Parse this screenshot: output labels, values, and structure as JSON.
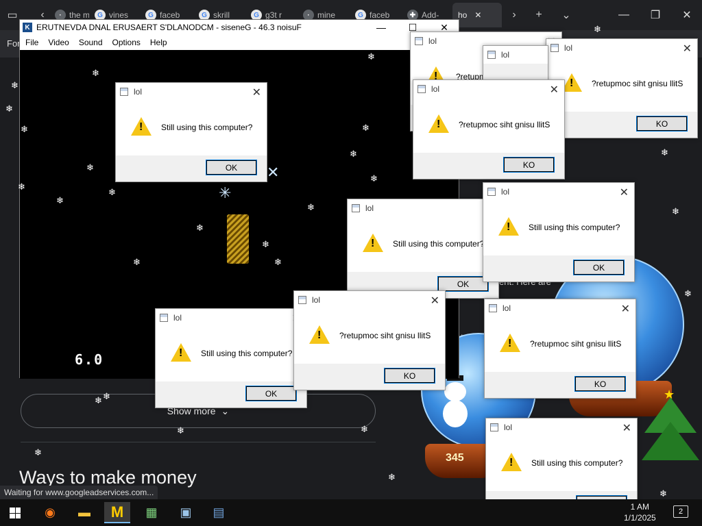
{
  "browser": {
    "tabs": [
      {
        "label": "the m",
        "icon": "page-icon"
      },
      {
        "label": "vines",
        "icon": "google-icon"
      },
      {
        "label": "faceb",
        "icon": "google-icon"
      },
      {
        "label": "skrill",
        "icon": "google-icon"
      },
      {
        "label": "g3t r",
        "icon": "google-icon"
      },
      {
        "label": "mine",
        "icon": "page-icon"
      },
      {
        "label": "faceb",
        "icon": "google-icon"
      },
      {
        "label": "Add-",
        "icon": "puzzle-icon"
      },
      {
        "label": "ho",
        "icon": "page-icon",
        "active": true
      }
    ],
    "page": {
      "nav_text": "For",
      "behind_text_1": "ent. Here are",
      "behind_text_2": "to",
      "show_more": "Show more",
      "heading": "Ways to make money"
    },
    "status_text": "Waiting for www.googleadservices.com..."
  },
  "emulator": {
    "title": "ERUTNEVDA   DNAL ERUSAERT     S'DLANODCM - siseneG - 46.3 noisuF",
    "menu": [
      "File",
      "Video",
      "Sound",
      "Options",
      "Help"
    ],
    "fps": "6.0"
  },
  "dialogs": [
    {
      "title": "lol",
      "message": "Still using this computer?",
      "button": "OK"
    },
    {
      "title": "lol",
      "message": "?retupmoc siht gnisu llitS",
      "button": "KO"
    },
    {
      "title": "lol",
      "message": "?retupmoc siht gnisu llitS",
      "button": "KO"
    },
    {
      "title": "lol",
      "message": "Still using this computer?",
      "button": "OK"
    },
    {
      "title": "lol",
      "message": "Still using this computer?",
      "button": "OK"
    },
    {
      "title": "lol",
      "message": "Still using this computer?",
      "button": "OK"
    },
    {
      "title": "lol",
      "message": "?retupmoc siht gnisu llitS",
      "button": "KO"
    },
    {
      "title": "lol",
      "message": "?retupmoc siht gnisu llitS",
      "button": "KO"
    },
    {
      "title": "lol",
      "message": "Still using this computer?",
      "button": "OK"
    }
  ],
  "decor": {
    "globe_counter": "345"
  },
  "taskbar": {
    "clock_time": "1 AM",
    "clock_date": "1/1/2025",
    "notifications": "2"
  },
  "colors": {
    "warning_yellow": "#f5c518",
    "taskbar_bg": "#101010",
    "page_bg": "#1c1d20"
  }
}
